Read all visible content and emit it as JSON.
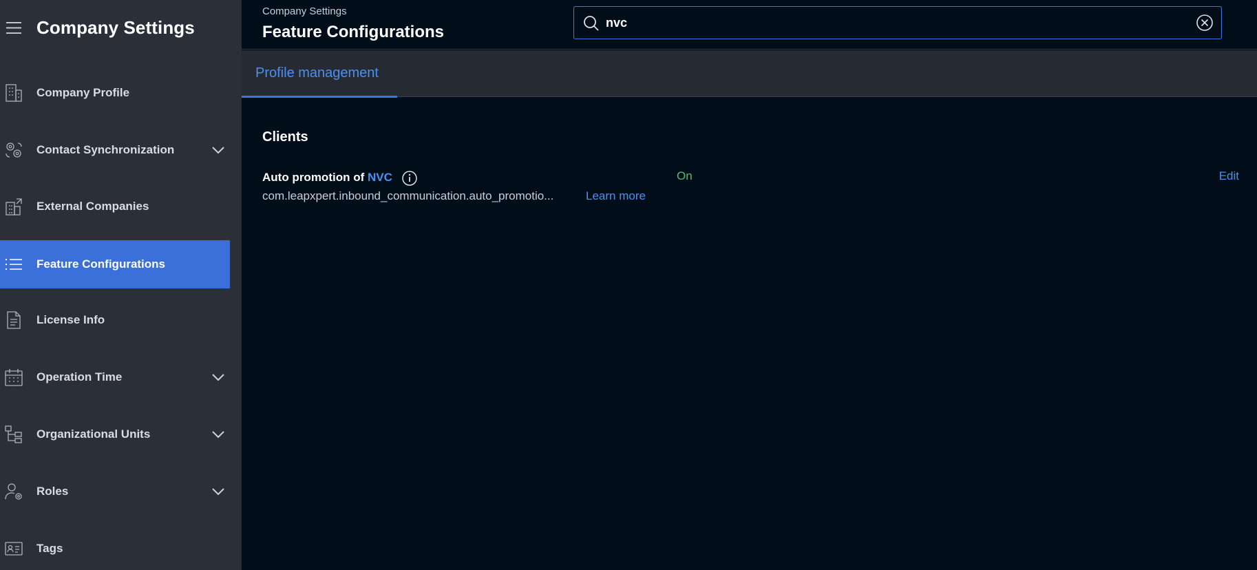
{
  "sidebar": {
    "title": "Company Settings",
    "items": [
      {
        "label": "Company Profile",
        "icon": "building-icon",
        "has_chevron": false,
        "active": false
      },
      {
        "label": "Contact Synchronization",
        "icon": "sync-gears-icon",
        "has_chevron": true,
        "active": false
      },
      {
        "label": "External Companies",
        "icon": "external-building-icon",
        "has_chevron": false,
        "active": false
      },
      {
        "label": "Feature Configurations",
        "icon": "list-icon",
        "has_chevron": false,
        "active": true
      },
      {
        "label": "License Info",
        "icon": "document-icon",
        "has_chevron": false,
        "active": false
      },
      {
        "label": "Operation Time",
        "icon": "calendar-icon",
        "has_chevron": true,
        "active": false
      },
      {
        "label": "Organizational Units",
        "icon": "org-tree-icon",
        "has_chevron": true,
        "active": false
      },
      {
        "label": "Roles",
        "icon": "user-gear-icon",
        "has_chevron": true,
        "active": false
      },
      {
        "label": "Tags",
        "icon": "id-card-icon",
        "has_chevron": false,
        "active": false
      }
    ]
  },
  "header": {
    "breadcrumb": "Company Settings",
    "title": "Feature Configurations"
  },
  "search": {
    "value": "nvc"
  },
  "tabs": [
    {
      "label": "Profile management",
      "active": true
    }
  ],
  "section": {
    "title": "Clients"
  },
  "feature": {
    "name_prefix": "Auto promotion of ",
    "name_highlight": "NVC",
    "key": "com.leapxpert.inbound_communication.auto_promotio...",
    "learn_more": "Learn more",
    "status": "On",
    "edit": "Edit"
  },
  "colors": {
    "accent": "#3b6fd9",
    "link": "#4d8ff0",
    "status_on": "#4fc07a",
    "sidebar_bg": "#2a2f38",
    "main_bg": "#020d1a"
  }
}
